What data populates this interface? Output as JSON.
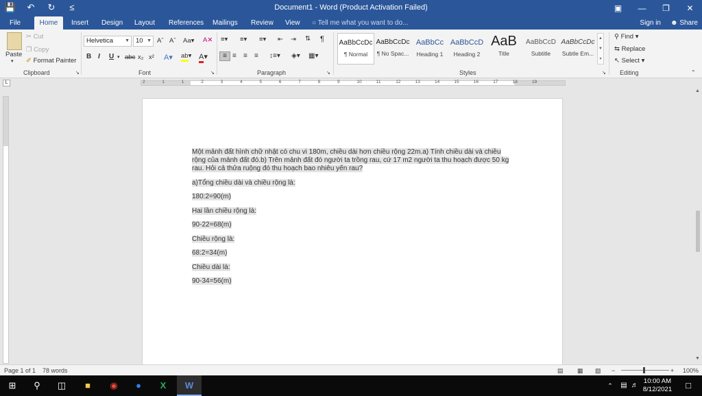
{
  "window": {
    "title": "Document1 - Word (Product Activation Failed)"
  },
  "tabs": [
    "File",
    "Home",
    "Insert",
    "Design",
    "Layout",
    "References",
    "Mailings",
    "Review",
    "View"
  ],
  "tell_me": "Tell me what you want to do...",
  "account": {
    "sign_in": "Sign in",
    "share": "Share"
  },
  "clipboard": {
    "paste": "Paste",
    "cut": "Cut",
    "copy": "Copy",
    "format_painter": "Format Painter",
    "label": "Clipboard"
  },
  "font": {
    "family": "Helvetica",
    "size": "10",
    "label": "Font"
  },
  "paragraph": {
    "label": "Paragraph"
  },
  "styles": {
    "label": "Styles",
    "items": [
      {
        "preview": "AaBbCcDc",
        "name": "¶ Normal"
      },
      {
        "preview": "AaBbCcDc",
        "name": "¶ No Spac..."
      },
      {
        "preview": "AaBbCc",
        "name": "Heading 1"
      },
      {
        "preview": "AaBbCcD",
        "name": "Heading 2"
      },
      {
        "preview": "AaB",
        "name": "Title"
      },
      {
        "preview": "AaBbCcD",
        "name": "Subtitle"
      },
      {
        "preview": "AaBbCcDc",
        "name": "Subtle Em..."
      }
    ]
  },
  "editing": {
    "find": "Find",
    "replace": "Replace",
    "select": "Select",
    "label": "Editing"
  },
  "ruler_numbers": [
    "2",
    "1",
    "1",
    "2",
    "3",
    "4",
    "5",
    "6",
    "7",
    "8",
    "9",
    "10",
    "11",
    "12",
    "13",
    "14",
    "15",
    "16",
    "17",
    "18",
    "19"
  ],
  "document": {
    "paragraphs": [
      "Một mảnh đất hình chữ nhật có chu vi 180m, chiều dài hơn chiều rộng 22m.a) Tính chiều dài và chiều rộng của mảnh đất đó.b) Trên mảnh đất đó người ta trồng rau, cứ 17 m2 người ta thu hoạch được 50 kg rau. Hỏi cả thửa ruộng đó thu hoạch bao nhiêu yến rau?",
      "a)Tổng chiều dài và chiều rộng là:",
      "180:2=90(m)",
      "Hai lần chiều rộng là:",
      "90-22=68(m)",
      "Chiều rộng là:",
      "68:2=34(m)",
      "Chiều dài là:",
      "90-34=56(m)"
    ]
  },
  "status": {
    "page": "Page 1 of 1",
    "words": "78 words",
    "zoom": "100%"
  },
  "taskbar": {
    "time": "10:00 AM",
    "date": "8/12/2021"
  },
  "colors": {
    "word_blue": "#2b579a",
    "ribbon_bg": "#f3f3f3",
    "taskbar_bg": "#0a0a0a"
  }
}
